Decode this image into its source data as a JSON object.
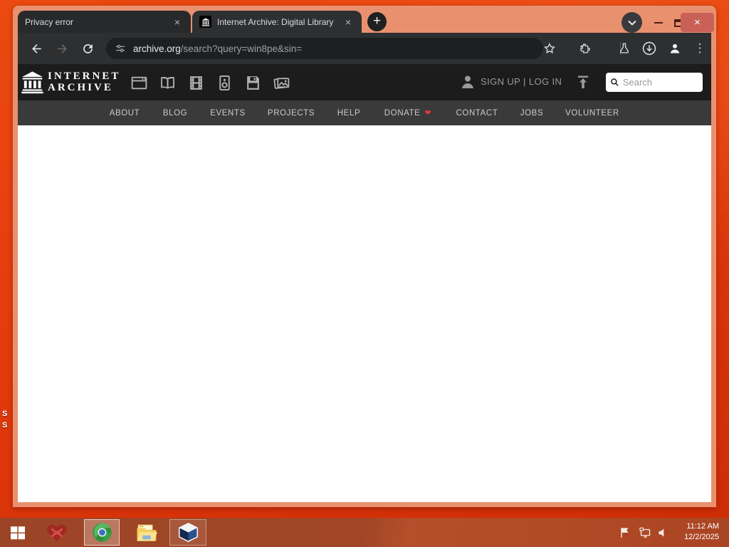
{
  "icons": {
    "close_glyph": "×",
    "plus_glyph": "+",
    "kebab_glyph": "⋮",
    "heart_glyph": "❤"
  },
  "colors": {
    "desktop": "#e23c0d",
    "window_frame": "#e9916f",
    "toolbar": "#2e2f31",
    "tab": "#27292b",
    "omnibox": "#1e1f21",
    "close_button": "#c96158",
    "archive_header": "#1c1c1c",
    "archive_nav": "#3a3a3a",
    "taskbar": "#a04627",
    "donate_heart": "#e03a3a"
  },
  "desktop": {
    "icon_fragments": [
      "S",
      "S"
    ]
  },
  "browser": {
    "tabs": [
      {
        "title": "Privacy error"
      },
      {
        "title": "Internet Archive: Digital Library"
      }
    ],
    "url_domain": "archive.org",
    "url_path": "/search?query=win8pe&sin="
  },
  "archive": {
    "logo_line1": "INTERNET",
    "logo_line2": "ARCHIVE",
    "auth_text": "SIGN UP | LOG IN",
    "search_placeholder": "Search",
    "media_types": [
      "web",
      "texts",
      "video",
      "audio",
      "software",
      "images"
    ],
    "nav": [
      "ABOUT",
      "BLOG",
      "EVENTS",
      "PROJECTS",
      "HELP",
      "DONATE",
      "CONTACT",
      "JOBS",
      "VOLUNTEER"
    ]
  },
  "taskbar": {
    "apps": [
      "start",
      "heart-app",
      "chrome",
      "file-explorer",
      "virtualbox"
    ],
    "time": "11:12 AM",
    "date": "12/2/2025"
  }
}
